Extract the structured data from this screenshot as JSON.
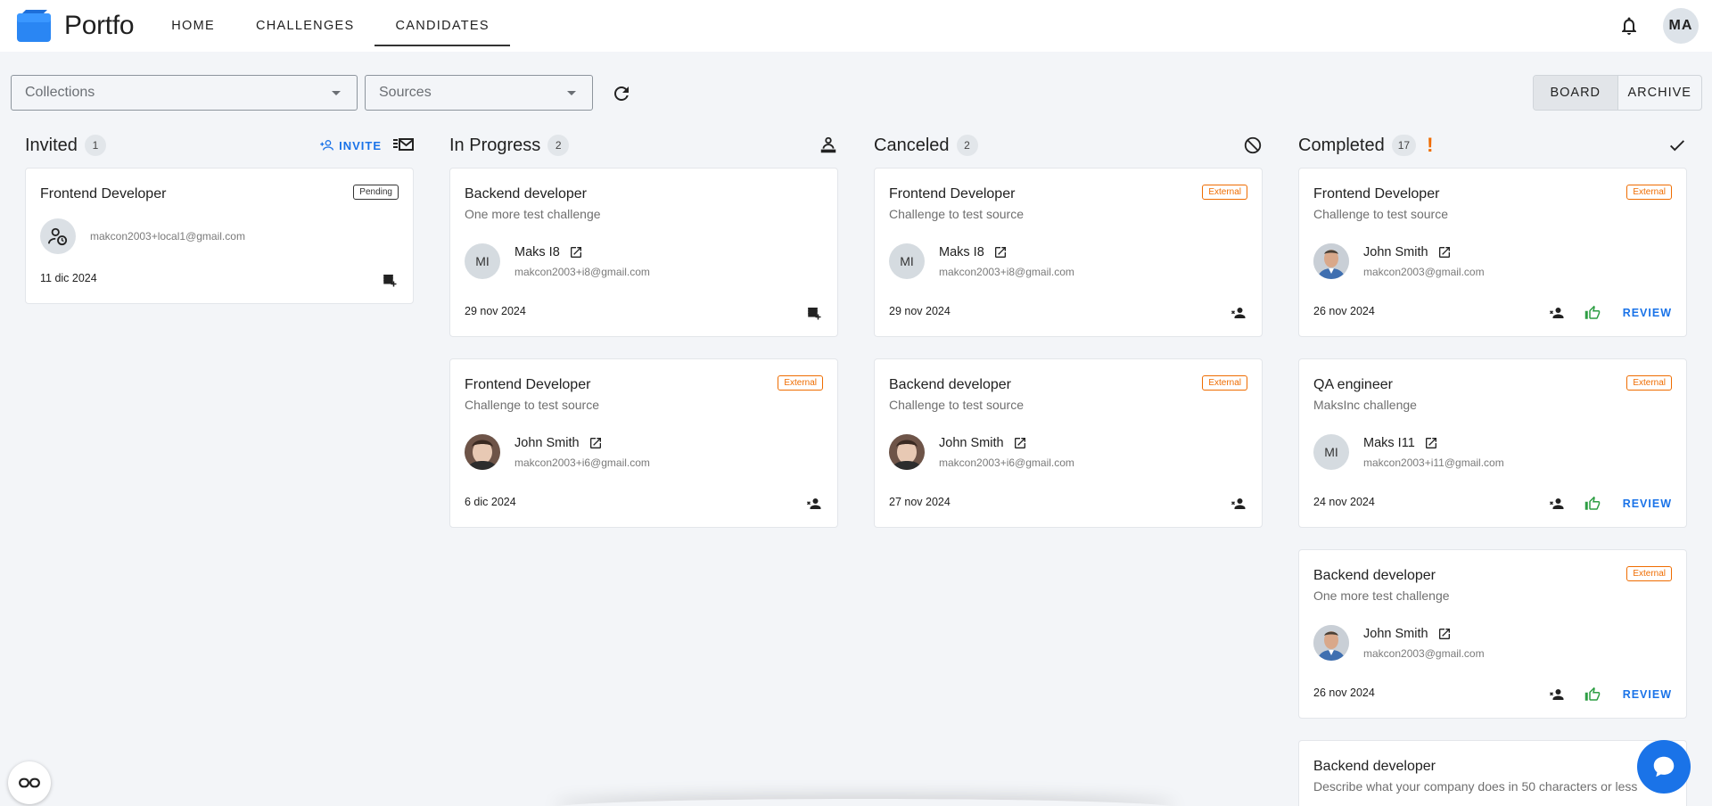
{
  "header": {
    "brand": "Portfo",
    "nav": [
      {
        "label": "HOME"
      },
      {
        "label": "CHALLENGES"
      },
      {
        "label": "CANDIDATES"
      }
    ],
    "user_initials": "MA"
  },
  "filters": {
    "collections_placeholder": "Collections",
    "sources_placeholder": "Sources"
  },
  "view_toggle": {
    "board": "BOARD",
    "archive": "ARCHIVE",
    "selected": "BOARD"
  },
  "columns": [
    {
      "title": "Invited",
      "count": "1",
      "invite_label": "INVITE",
      "cards": [
        {
          "title": "Frontend Developer",
          "badge": "Pending",
          "email": "makcon2003+local1@gmail.com",
          "date": "11 dic 2024"
        }
      ]
    },
    {
      "title": "In Progress",
      "count": "2",
      "cards": [
        {
          "title": "Backend developer",
          "subtitle": "One more test challenge",
          "initials": "MI",
          "name": "Maks I8",
          "email": "makcon2003+i8@gmail.com",
          "date": "29 nov 2024"
        },
        {
          "title": "Frontend Developer",
          "subtitle": "Challenge to test source",
          "badge": "External",
          "name": "John Smith",
          "email": "makcon2003+i6@gmail.com",
          "date": "6 dic 2024"
        }
      ]
    },
    {
      "title": "Canceled",
      "count": "2",
      "cards": [
        {
          "title": "Frontend Developer",
          "subtitle": "Challenge to test source",
          "badge": "External",
          "initials": "MI",
          "name": "Maks I8",
          "email": "makcon2003+i8@gmail.com",
          "date": "29 nov 2024"
        },
        {
          "title": "Backend developer",
          "subtitle": "Challenge to test source",
          "badge": "External",
          "name": "John Smith",
          "email": "makcon2003+i6@gmail.com",
          "date": "27 nov 2024"
        }
      ]
    },
    {
      "title": "Completed",
      "count": "17",
      "alert": "!",
      "cards": [
        {
          "title": "Frontend Developer",
          "subtitle": "Challenge to test source",
          "badge": "External",
          "name": "John Smith",
          "email": "makcon2003@gmail.com",
          "date": "26 nov 2024",
          "review": "REVIEW"
        },
        {
          "title": "QA engineer",
          "subtitle": "MaksInc challenge",
          "badge": "External",
          "initials": "MI",
          "name": "Maks I11",
          "email": "makcon2003+i11@gmail.com",
          "date": "24 nov 2024",
          "review": "REVIEW"
        },
        {
          "title": "Backend developer",
          "subtitle": "One more test challenge",
          "badge": "External",
          "name": "John Smith",
          "email": "makcon2003@gmail.com",
          "date": "26 nov 2024",
          "review": "REVIEW"
        },
        {
          "title": "Backend developer",
          "subtitle": "Describe what your company does in 50 characters or less"
        }
      ]
    }
  ],
  "colors": {
    "accent": "#1a73e8",
    "external": "#ef6c00",
    "like": "#2e9e44"
  }
}
